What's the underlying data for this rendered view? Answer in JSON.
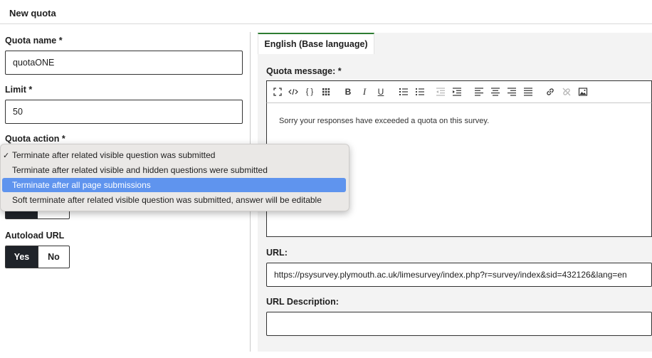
{
  "header": {
    "title": "New quota"
  },
  "form": {
    "quota_name": {
      "label": "Quota name *",
      "value": "quotaONE"
    },
    "limit": {
      "label": "Limit *",
      "value": "50"
    },
    "quota_action": {
      "label": "Quota action *",
      "options": [
        "Terminate after related visible question was submitted",
        "Terminate after related visible and hidden questions were submitted",
        "Terminate after all page submissions",
        "Soft terminate after related visible question was submitted, answer will be editable"
      ],
      "checked_index": 0,
      "highlighted_index": 2,
      "check_mark": "✓"
    },
    "autoload_url": {
      "label": "Autoload URL",
      "yes": "Yes",
      "no": "No",
      "selected": "Yes"
    }
  },
  "language_tab": {
    "label": "English (Base language)"
  },
  "quota_message": {
    "label": "Quota message: *",
    "text": "Sorry your responses have exceeded a quota on this survey.",
    "toolbar_icons": [
      "fullscreen-icon",
      "source-code-icon",
      "curly-braces-icon",
      "grid-icon",
      "bold-icon",
      "italic-icon",
      "underline-icon",
      "numbered-list-icon",
      "bulleted-list-icon",
      "outdent-icon",
      "indent-icon",
      "align-left-icon",
      "align-center-icon",
      "align-right-icon",
      "justify-icon",
      "link-icon",
      "unlink-icon",
      "image-icon"
    ]
  },
  "url": {
    "label": "URL:",
    "value": "https://psysurvey.plymouth.ac.uk/limesurvey/index.php?r=survey/index&sid=432126&lang=en"
  },
  "url_description": {
    "label": "URL Description:",
    "value": ""
  },
  "colors": {
    "accent_tab": "#2e7d32",
    "toggle_active": "#1f2329",
    "dropdown_highlight": "#5f94ee"
  }
}
